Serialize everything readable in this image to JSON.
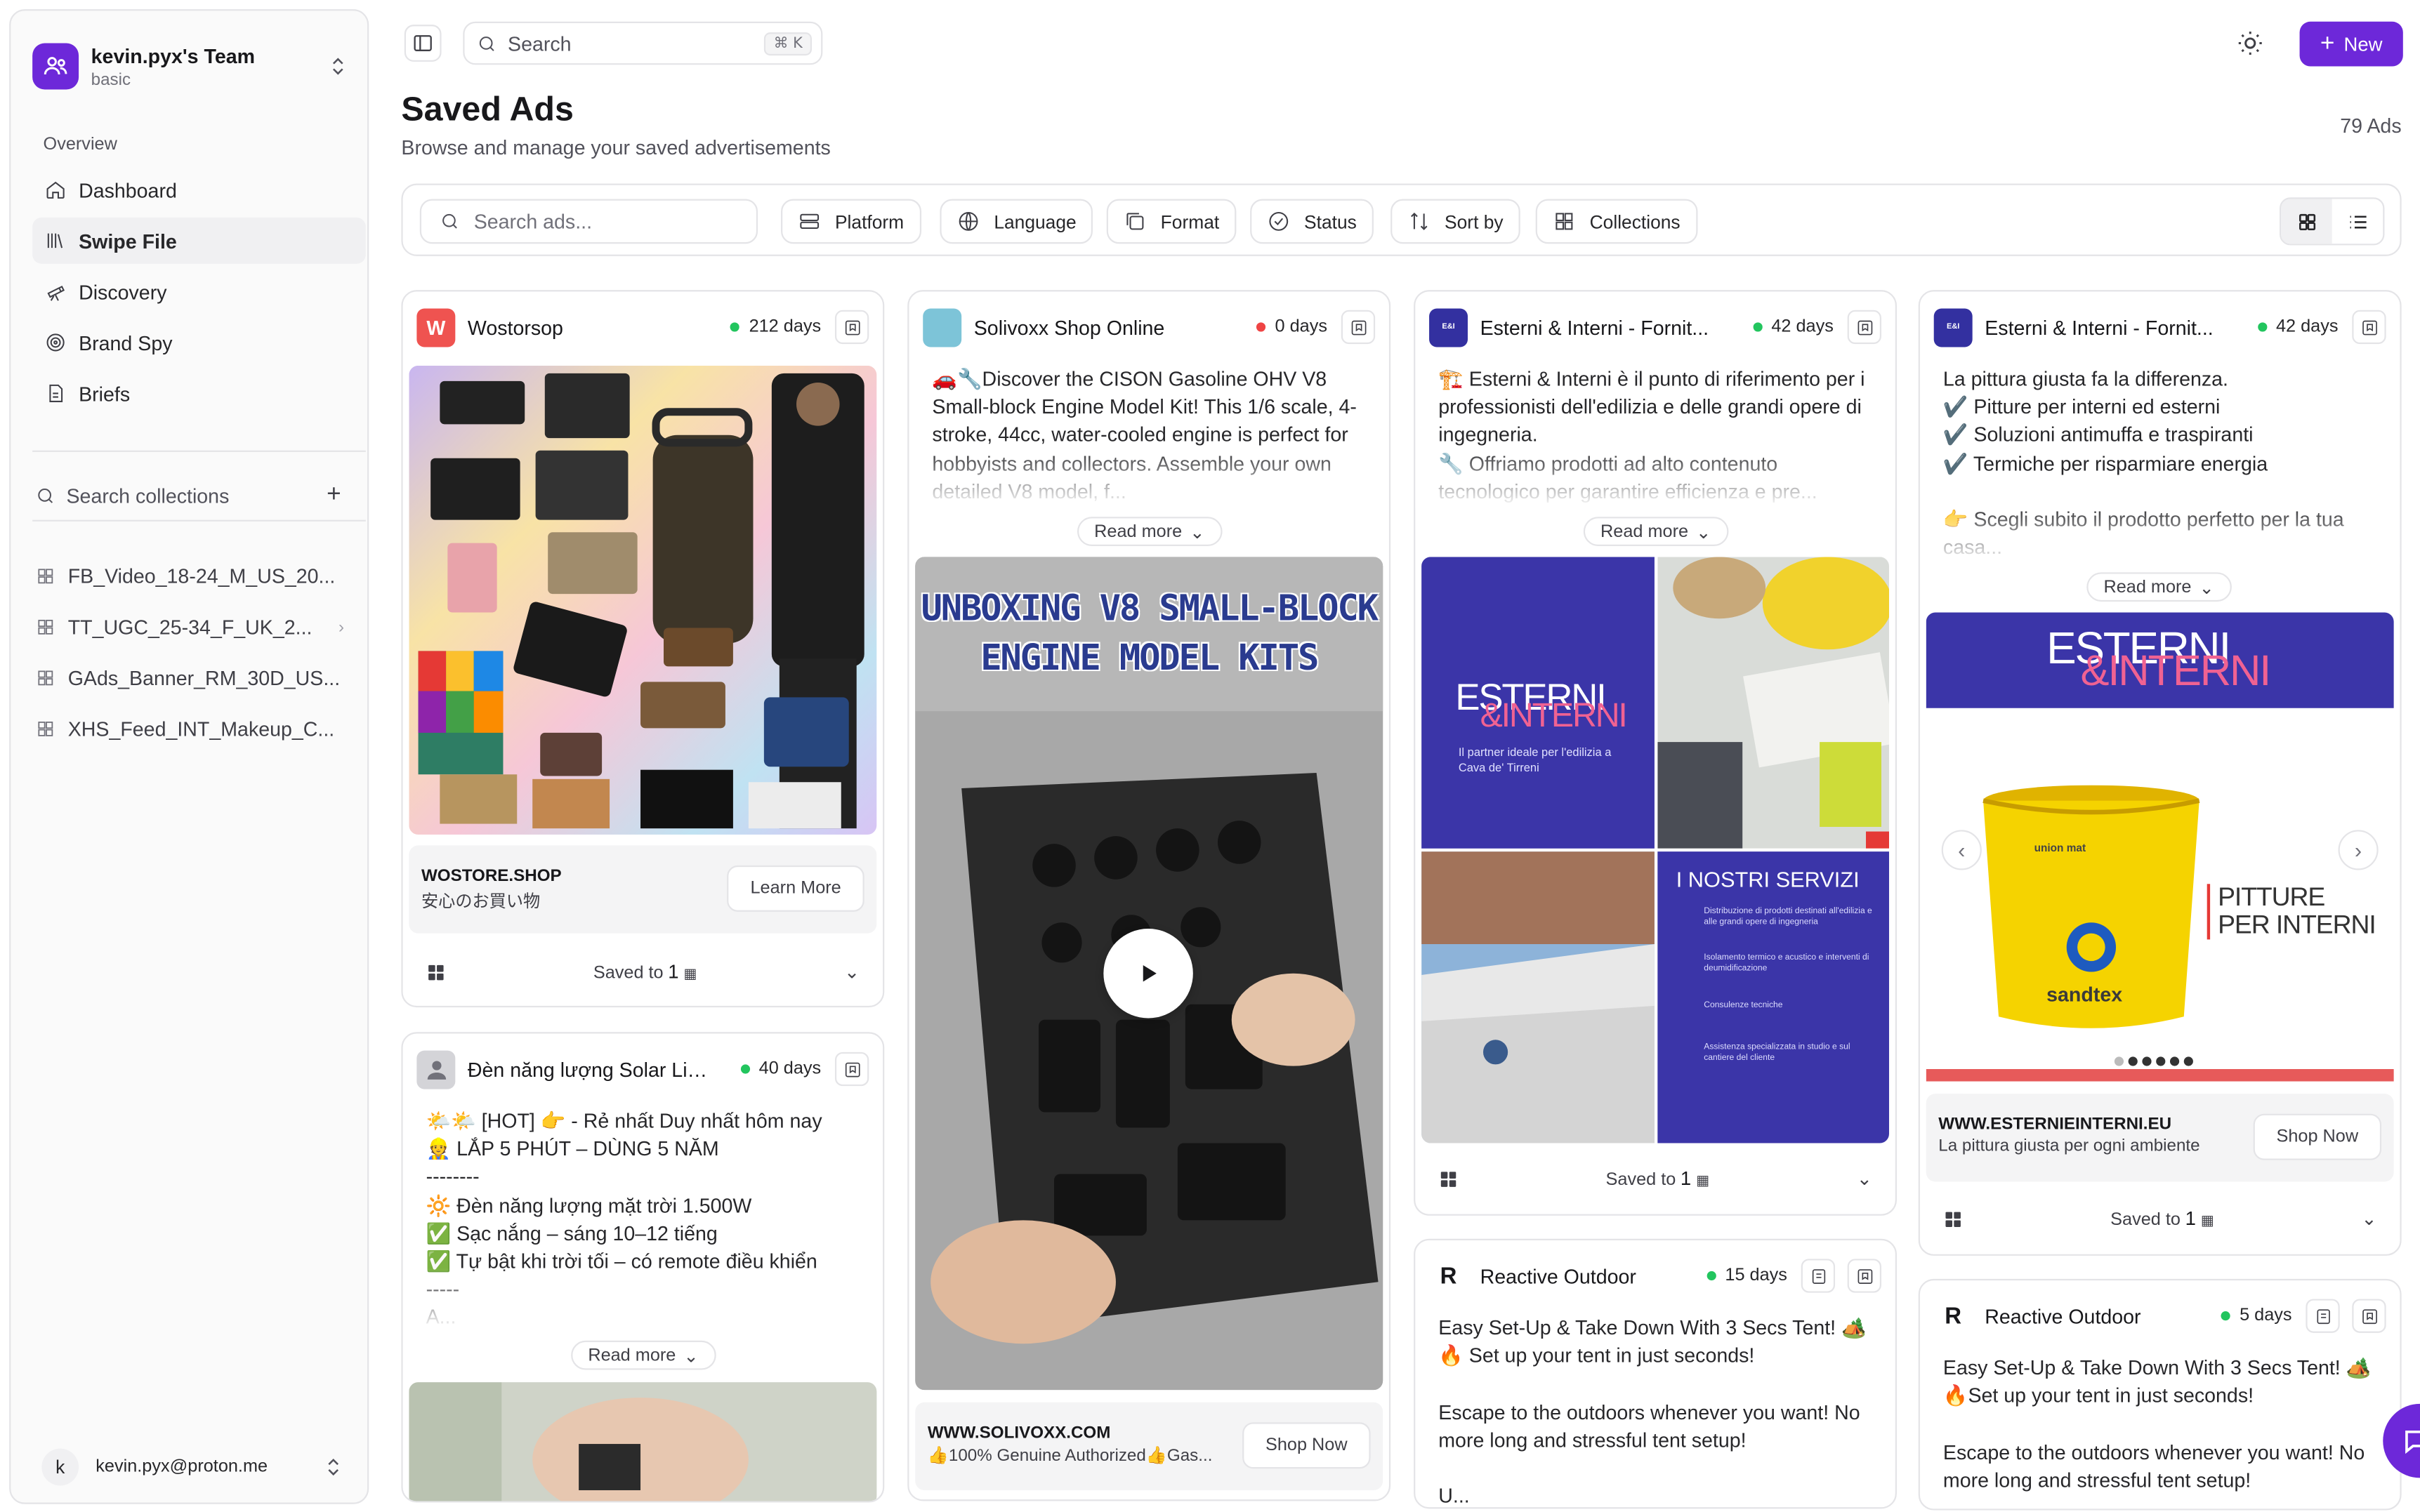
{
  "sidebar": {
    "team_name": "kevin.pyx's Team",
    "team_plan": "basic",
    "section_label": "Overview",
    "nav": [
      {
        "label": "Dashboard",
        "icon": "home-icon"
      },
      {
        "label": "Swipe File",
        "icon": "library-icon"
      },
      {
        "label": "Discovery",
        "icon": "telescope-icon"
      },
      {
        "label": "Brand Spy",
        "icon": "radar-icon"
      },
      {
        "label": "Briefs",
        "icon": "file-icon"
      }
    ],
    "search_collections": "Search collections",
    "collections": [
      "FB_Video_18-24_M_US_20...",
      "TT_UGC_25-34_F_UK_2...",
      "GAds_Banner_RM_30D_US...",
      "XHS_Feed_INT_Makeup_C..."
    ],
    "user_initial": "k",
    "user_email": "kevin.pyx@proton.me"
  },
  "topbar": {
    "search_placeholder": "Search",
    "shortcut": "⌘ K",
    "new_label": "New"
  },
  "header": {
    "title": "Saved Ads",
    "subtitle": "Browse and manage your saved advertisements",
    "count": "79 Ads"
  },
  "filters": {
    "search_placeholder": "Search ads...",
    "platform": "Platform",
    "language": "Language",
    "format": "Format",
    "status": "Status",
    "sort": "Sort by",
    "collections": "Collections"
  },
  "cards": {
    "c1": {
      "brand": "Wostorsop",
      "logo": "W",
      "days": "212 days",
      "cta_url": "WOSTORE.SHOP",
      "cta_sub": "安心のお買い物",
      "cta_btn": "Learn More",
      "saved": "Saved to",
      "saved_count": "1"
    },
    "c2": {
      "brand": "Đèn năng lượng Solar Lig...",
      "days": "40 days",
      "text": "🌤️🌤️ [HOT] 👉 - Rẻ nhất Duy nhất hôm nay\n👷 LẮP 5 PHÚT – DÙNG 5 NĂM\n--------\n🔆 Đèn năng lượng mặt trời 1.500W\n✅ Sạc nắng – sáng 10–12 tiếng\n✅ Tự bật khi trời tối – có remote điều khiển\n-----\nA...",
      "read_more": "Read more"
    },
    "c3": {
      "brand": "Solivoxx Shop Online",
      "days": "0 days",
      "text": "🚗🔧Discover the CISON Gasoline OHV V8 Small-block Engine Model Kit! This 1/6 scale, 4-stroke, 44cc, water-cooled engine is perfect for hobbyists and collectors. Assemble your own detailed V8 model, f...",
      "read_more": "Read more",
      "video_title": "UNBOXING V8 SMALL-BLOCK ENGINE MODEL KITS",
      "cta_url": "WWW.SOLIVOXX.COM",
      "cta_sub": "👍100% Genuine Authorized👍Gas...",
      "cta_btn": "Shop Now"
    },
    "c4": {
      "brand": "Esterni & Interni - Fornit...",
      "days": "42 days",
      "text": "🏗️ Esterni & Interni è il punto di riferimento per i professionisti dell'edilizia e delle grandi opere di ingegneria.\n🔧 Offriamo prodotti ad alto contenuto tecnologico per garantire efficienza e pre...",
      "read_more": "Read more",
      "img_logo_a": "ESTERNI",
      "img_logo_b": "&INTERNI",
      "img_tagline": "Il partner ideale per l'edilizia a Cava de' Tirreni",
      "img_services_title": "I NOSTRI SERVIZI",
      "services": [
        "Distribuzione di prodotti destinati all'edilizia e alle grandi opere di ingegneria",
        "Isolamento termico e acustico e interventi di deumidificazione",
        "Consulenze tecniche",
        "Assistenza specializzata in studio e sul cantiere del cliente"
      ],
      "saved": "Saved to",
      "saved_count": "1"
    },
    "c5": {
      "brand": "Reactive Outdoor",
      "days": "15 days",
      "text": "Easy Set-Up & Take Down With 3 Secs Tent! 🏕️\n🔥 Set up your tent in just seconds!\n\nEscape to the outdoors whenever you want! No more long and stressful tent setup!\n\nU..."
    },
    "c6": {
      "brand": "Esterni & Interni - Fornit...",
      "days": "42 days",
      "text": "La pittura giusta fa la differenza.\n✔️ Pitture per interni ed esterni\n✔️ Soluzioni antimuffa e traspiranti\n✔️ Termiche per risparmiare energia\n\n👉 Scegli subito il prodotto perfetto per la tua casa...",
      "read_more": "Read more",
      "img_logo_a": "ESTERNI",
      "img_logo_b": "&INTERNI",
      "bucket_label": "sandtex",
      "bucket_brand": "union mat",
      "pitture_a": "PITTURE",
      "pitture_b": "PER INTERNI",
      "cta_url": "WWW.ESTERNIEINTERNI.EU",
      "cta_sub": "La pittura giusta per ogni ambiente",
      "cta_btn": "Shop Now",
      "saved": "Saved to",
      "saved_count": "1"
    },
    "c7": {
      "brand": "Reactive Outdoor",
      "days": "5 days",
      "text": "Easy Set-Up & Take Down With 3 Secs Tent! 🏕️\n🔥Set up your tent in just seconds!\n\nEscape to the outdoors whenever you want! No more long and stressful tent setup!"
    }
  },
  "colors": {
    "accent": "#6d28d9",
    "status_green": "#22c55e",
    "status_red": "#ef4444",
    "esterni_blue": "#3330a0"
  }
}
